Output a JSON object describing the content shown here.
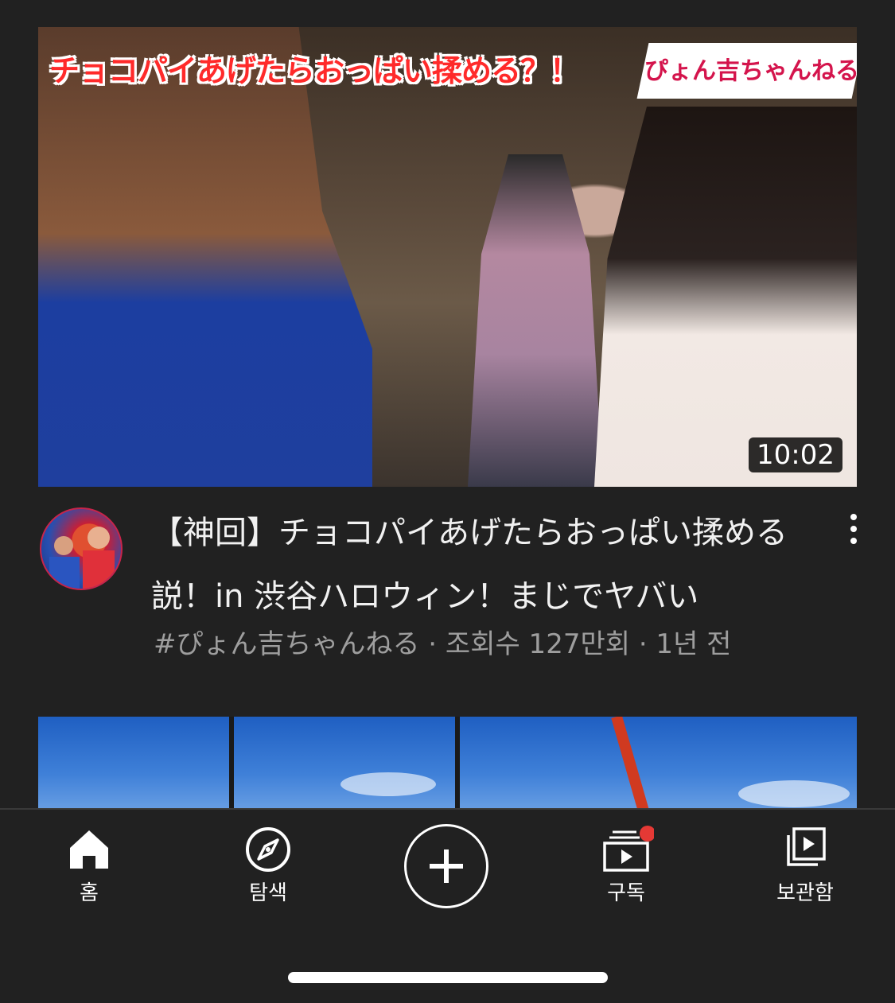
{
  "video1": {
    "thumbnail_title": "チョコパイあげたらおっぱい揉める？！",
    "thumbnail_channel": "ぴょん吉ちゃんねる",
    "duration": "10:02",
    "title": "【神回】チョコパイあげたらおっぱい揉める説！in 渋谷ハロウィン！まじでヤバい",
    "meta": "#ぴょん吉ちゃんねる · 조회수 127만회 · 1년 전",
    "avatar": "channel-avatar",
    "more_icon": "more-vert-icon"
  },
  "nav": {
    "items": [
      {
        "label": "홈",
        "icon": "home-icon"
      },
      {
        "label": "탐색",
        "icon": "compass-icon"
      },
      {
        "label": "",
        "icon": "add-icon"
      },
      {
        "label": "구독",
        "icon": "subscriptions-icon"
      },
      {
        "label": "보관함",
        "icon": "library-icon"
      }
    ]
  },
  "colors": {
    "background": "#212121",
    "notification_dot": "#e53935",
    "meta_text": "#9e9e9e"
  }
}
